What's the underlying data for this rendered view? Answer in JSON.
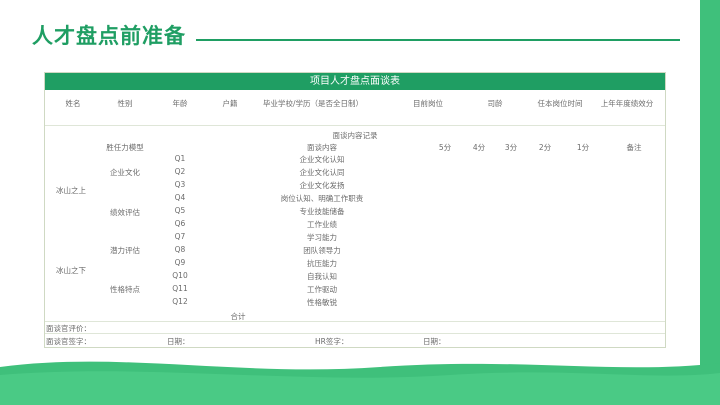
{
  "page": {
    "title": "人才盘点前准备"
  },
  "table": {
    "title": "项目人才盘点面谈表",
    "headers": [
      "姓名",
      "性别",
      "年龄",
      "户籍",
      "毕业学校/学历（是否全日制）",
      "目前岗位",
      "司龄",
      "任本岗位时间",
      "上年年度绩效分"
    ],
    "section_title": "面谈内容记录",
    "subheader": {
      "category": "胜任力模型",
      "content": "面谈内容",
      "scores": [
        "5分",
        "4分",
        "3分",
        "2分",
        "1分"
      ],
      "remark": "备注"
    },
    "groups": [
      "冰山之上",
      "冰山之下"
    ],
    "categories": [
      "企业文化",
      "绩效评估",
      "潜力评估",
      "性格特点"
    ],
    "questions": [
      {
        "q": "Q1",
        "content": "企业文化认知"
      },
      {
        "q": "Q2",
        "content": "企业文化认同"
      },
      {
        "q": "Q3",
        "content": "企业文化发扬"
      },
      {
        "q": "Q4",
        "content": "岗位认知、明确工作职责"
      },
      {
        "q": "Q5",
        "content": "专业技能储备"
      },
      {
        "q": "Q6",
        "content": "工作业绩"
      },
      {
        "q": "Q7",
        "content": "学习能力"
      },
      {
        "q": "Q8",
        "content": "团队领导力"
      },
      {
        "q": "Q9",
        "content": "抗压能力"
      },
      {
        "q": "Q10",
        "content": "自我认知"
      },
      {
        "q": "Q11",
        "content": "工作驱动"
      },
      {
        "q": "Q12",
        "content": "性格敏锐"
      }
    ],
    "total": "合计",
    "evaluation": "面谈官评价：",
    "footer": {
      "sign": "面谈官签字：",
      "date1": "日期：",
      "hr_sign": "HR签字：",
      "date2": "日期："
    }
  },
  "colors": {
    "accent": "#1f9e63",
    "background": "#3fc07b"
  }
}
